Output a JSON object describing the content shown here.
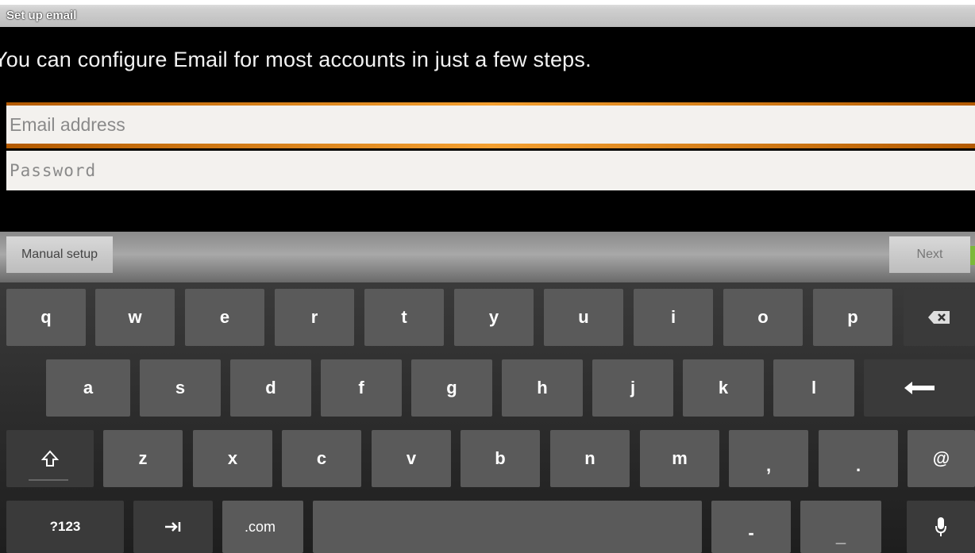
{
  "title_bar": {
    "title": "Set up email"
  },
  "instruction": "You can configure Email for most accounts in just a few steps.",
  "form": {
    "email_placeholder": "Email address",
    "password_placeholder": "Password"
  },
  "actions": {
    "manual_setup": "Manual setup",
    "next": "Next"
  },
  "colors": {
    "accent": "#f4a030",
    "next_indicator": "#7cb83a"
  },
  "keyboard": {
    "row1": [
      "q",
      "w",
      "e",
      "r",
      "t",
      "y",
      "u",
      "i",
      "o",
      "p"
    ],
    "row2": [
      "a",
      "s",
      "d",
      "f",
      "g",
      "h",
      "j",
      "k",
      "l"
    ],
    "row3": [
      "z",
      "x",
      "c",
      "v",
      "b",
      "n",
      "m",
      ",",
      "."
    ],
    "at": "@",
    "symbols": "?123",
    "dotcom": ".com",
    "dash": "-",
    "underscore": "_",
    "icons": [
      "backspace-icon",
      "enter-icon",
      "shift-icon",
      "tab-icon",
      "microphone-icon"
    ]
  }
}
